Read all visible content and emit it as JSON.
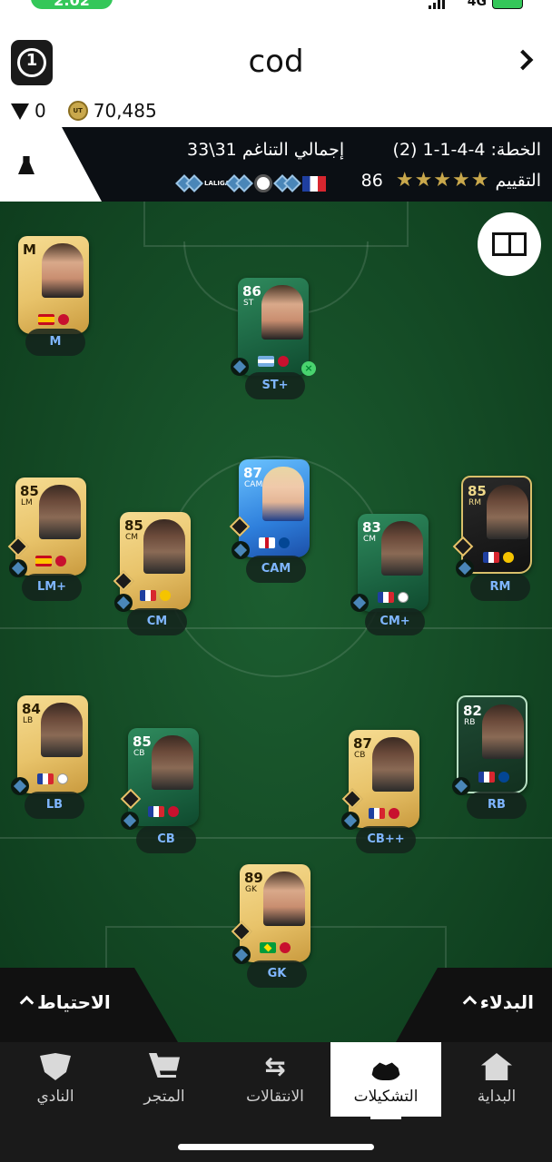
{
  "status": {
    "time": "2:02",
    "network": "4G"
  },
  "header": {
    "title": "cod",
    "fut_points": "0",
    "coins": "70,485",
    "coin_text": "UT"
  },
  "info": {
    "formation": "الخطة: 4-4-1-1 (2)",
    "total_chem": "إجمالي التناغم 31\\33",
    "rating_label": "التقييم",
    "rating": "86",
    "stars": "★★★★★",
    "chips": [
      "LALIGA"
    ]
  },
  "players": [
    {
      "name": "unrated-manager",
      "rating": "M",
      "pos": "",
      "pill": "M",
      "flag": "f-es",
      "crest": "red",
      "style": "gold",
      "face": "light"
    },
    {
      "name": "st",
      "rating": "86",
      "pos": "ST",
      "pill": "ST+",
      "flag": "f-ar",
      "crest": "red",
      "style": "green",
      "face": "light"
    },
    {
      "name": "lm",
      "rating": "85",
      "pos": "LM",
      "pill": "LM+",
      "flag": "f-es",
      "crest": "red",
      "style": "gold",
      "face": ""
    },
    {
      "name": "cm-left",
      "rating": "85",
      "pos": "CM",
      "pill": "CM",
      "flag": "f-fr",
      "crest": "yellow",
      "style": "gold",
      "face": ""
    },
    {
      "name": "cam",
      "rating": "87",
      "pos": "CAM",
      "pill": "CAM",
      "flag": "f-en",
      "crest": "blue",
      "style": "blue",
      "face": "fair"
    },
    {
      "name": "cm-right",
      "rating": "83",
      "pos": "CM",
      "pill": "CM+",
      "flag": "f-fr",
      "crest": "white",
      "style": "green",
      "face": ""
    },
    {
      "name": "rm",
      "rating": "85",
      "pos": "RM",
      "pill": "RM",
      "flag": "f-fr",
      "crest": "yellow",
      "style": "black",
      "face": ""
    },
    {
      "name": "lb",
      "rating": "84",
      "pos": "LB",
      "pill": "LB",
      "flag": "f-fr",
      "crest": "white",
      "style": "gold",
      "face": ""
    },
    {
      "name": "cb-left",
      "rating": "85",
      "pos": "CB",
      "pill": "CB",
      "flag": "f-fr",
      "crest": "red",
      "style": "green",
      "face": ""
    },
    {
      "name": "cb-right",
      "rating": "87",
      "pos": "CB",
      "pill": "CB++",
      "flag": "f-fr",
      "crest": "red",
      "style": "gold",
      "face": ""
    },
    {
      "name": "rb",
      "rating": "82",
      "pos": "RB",
      "pill": "RB",
      "flag": "f-fr",
      "crest": "blue",
      "style": "darkgreen",
      "face": ""
    },
    {
      "name": "gk",
      "rating": "89",
      "pos": "GK",
      "pill": "GK",
      "flag": "f-br",
      "crest": "red",
      "style": "gold",
      "face": "light"
    }
  ],
  "bench": {
    "reserves": "الاحتياط",
    "subs": "البدلاء"
  },
  "nav": [
    {
      "id": "home",
      "label": "البداية"
    },
    {
      "id": "squads",
      "label": "التشكيلات"
    },
    {
      "id": "transfers",
      "label": "الانتقالات"
    },
    {
      "id": "store",
      "label": "المتجر"
    },
    {
      "id": "club",
      "label": "النادي"
    }
  ]
}
